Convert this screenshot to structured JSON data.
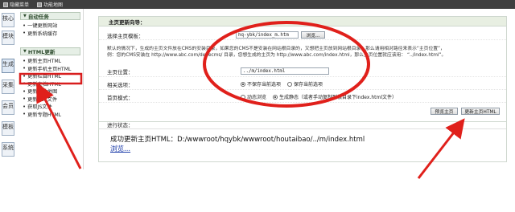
{
  "topbar": {
    "items": [
      "隐藏菜单",
      "功能地图"
    ]
  },
  "vtabs": [
    "核心",
    "模块",
    "生成",
    "采集",
    "会员",
    "模板",
    "系统"
  ],
  "sidebar": {
    "sections": [
      {
        "title": "自动任务",
        "items": [
          "一键更新网站",
          "更新系统缓存"
        ]
      },
      {
        "title": "HTML更新",
        "items": [
          "更新主页HTML",
          "更新手机主页HTML",
          "更新栏目HTML",
          "更新文档HTML",
          "更新网站地图",
          "更新RSS文件",
          "获取JS文件",
          "更新专题HTML"
        ]
      }
    ]
  },
  "main": {
    "title": "主页更新向导：",
    "template": {
      "label": "选择主页模板：",
      "value": "hq-ybk/index_m.htm",
      "button": "浏览..."
    },
    "description": [
      "默认的情况下，生成的主页文件放在CMS的安装目录，如果您的CMS不是安装在网站根目录的，又想把主页放到网站根目录，那么请用相对路径来表示“主页位置”，",
      "例：您的CMS安装在 http://www.abc.com/dedecms/ 目录，您想生成的主页为 http://www.abc.com/index.html，那么主页位置就应该用： “../index.html”。"
    ],
    "location": {
      "label": "主页位置：",
      "value": "../m/index.html"
    },
    "related": {
      "label": "相关选项：",
      "options": [
        "不保存当前选项",
        "保存当前选项"
      ],
      "selected": 0
    },
    "mode": {
      "label": "首页模式：",
      "options": [
        "动态浏览",
        "生成静态（或者手动复制到根目录下index.html文件）"
      ],
      "selected": 1
    },
    "buttons": {
      "preview": "预览主页",
      "update": "更新主页HTML"
    }
  },
  "progress": {
    "label": "进行状态：",
    "message": "成功更新主页HTML：D:/wwwroot/hqybk/wwwroot/houtaibao/../m/index.html",
    "link": "浏览..."
  },
  "colors": {
    "annotation": "#e0201b",
    "section_bg": "#e8efe2",
    "highlight": "#d81e1e"
  }
}
